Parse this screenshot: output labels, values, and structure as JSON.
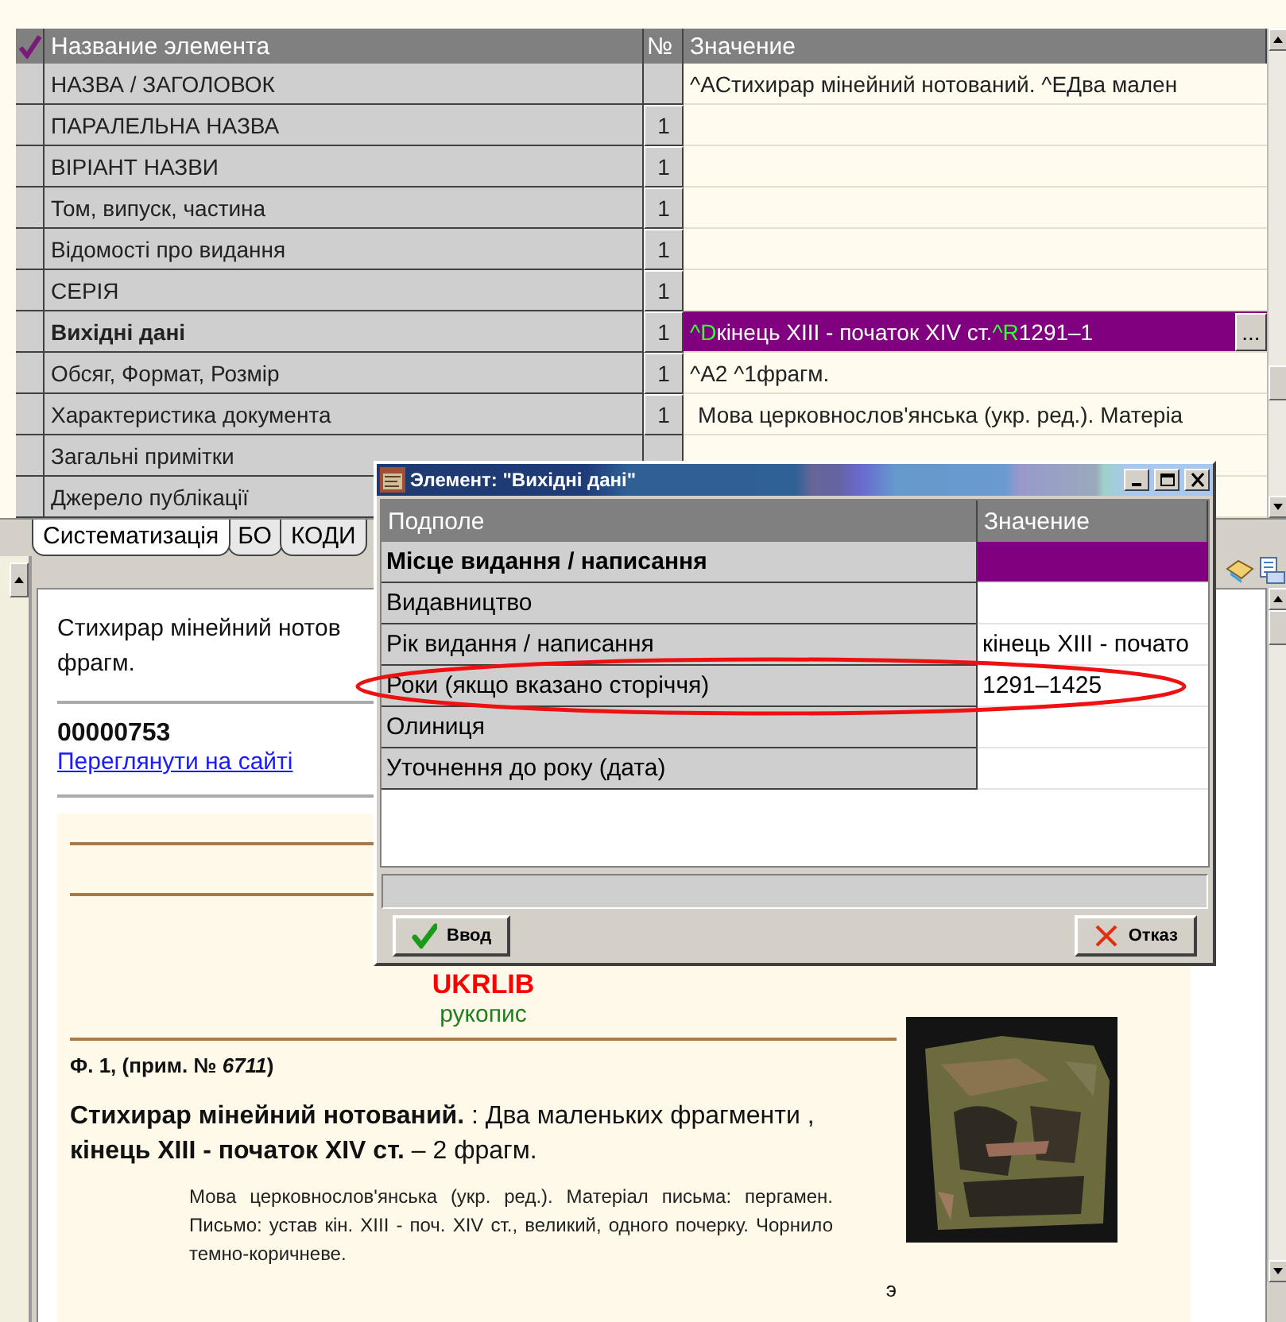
{
  "fields_table": {
    "columns": [
      "Название элемента",
      "№",
      "Значение"
    ],
    "rows": [
      {
        "name": "НАЗВА / ЗАГОЛОВОК",
        "value": "^AСтихирар мінейний нотований. ^EДва мален",
        "selected": false
      },
      {
        "name": "ПАРАЛЕЛЬНА НАЗВА",
        "number": "1",
        "selected": false
      },
      {
        "name": "ВІРІАНТ НАЗВИ",
        "number": "1",
        "selected": false
      },
      {
        "name": "Том, випуск, частина",
        "number": "1",
        "selected": false
      },
      {
        "name": "Відомості про видання",
        "number": "1",
        "selected": false
      },
      {
        "name": "СЕРІЯ",
        "number": "1",
        "selected": false
      },
      {
        "name": "Вихідні дані",
        "number": "1",
        "selected": true,
        "value_parts": [
          {
            "text": "^D",
            "kind": "code"
          },
          {
            "text": "кінець XIII - початок XIV ст.",
            "kind": "text"
          },
          {
            "text": "^R",
            "kind": "code"
          },
          {
            "text": "1291–1",
            "kind": "text"
          }
        ],
        "edit_button": "..."
      },
      {
        "name": "Обсяг, Формат, Розмір",
        "number": "1",
        "value": "^A2 ^1фрагм.",
        "selected": false
      },
      {
        "name": "Характеристика документа",
        "number": "1",
        "value": "Мова церковнослов'янська (укр. ред.). Матеріа",
        "selected": false
      },
      {
        "name": "Загальні примітки",
        "selected": false
      },
      {
        "name": "Джерело публікації",
        "selected": false
      }
    ]
  },
  "tabs": [
    {
      "label": "Систематизація",
      "selected": true
    },
    {
      "label": "БО",
      "selected": false
    },
    {
      "label": "КОДИ",
      "selected": false
    }
  ],
  "preview": {
    "title_lines": [
      "Стихирар мінейний нотов",
      "фрагм."
    ],
    "record_id": "00000753",
    "link": "Переглянути на сайті",
    "source": "UKRLIB",
    "source_type": "рукопис",
    "shelfmark": "Ф. 1, (прим. № *6711*)",
    "description": "**Стихирар мінейний нотований.** : Два маленьких фрагменти , **кінець XIII - початок XIV ст.** – 2 фрагм.",
    "notes": "Мова церковнослов'янська (укр. ред.). Матеріал письма: пергамен. Письмо: устав кін. XIII - поч. XIV ст., великий, одного почерку. Чорнило темно-коричневе.",
    "mark": "э",
    "image": {
      "kind": "picture"
    }
  },
  "dialog": {
    "title": "Элемент: \"Вихідні дані\"",
    "columns": [
      "Подполе",
      "Значение"
    ],
    "rows": [
      {
        "name": "Місце видання / написання",
        "selected": true
      },
      {
        "name": "Видавництво",
        "selected": false
      },
      {
        "name": "Рік видання / написання",
        "value": "кінець XIII - почато",
        "selected": false
      },
      {
        "name": "Роки (якщо вказано сторіччя)",
        "value": "1291–1425",
        "selected": false,
        "circled": true
      },
      {
        "name": "Олиниця",
        "selected": false
      },
      {
        "name": "Уточнення до року (дата)",
        "selected": false
      }
    ],
    "buttons": [
      {
        "label": "Ввод",
        "kind": "ok"
      },
      {
        "label": "Отказ",
        "kind": "cancel"
      }
    ]
  }
}
